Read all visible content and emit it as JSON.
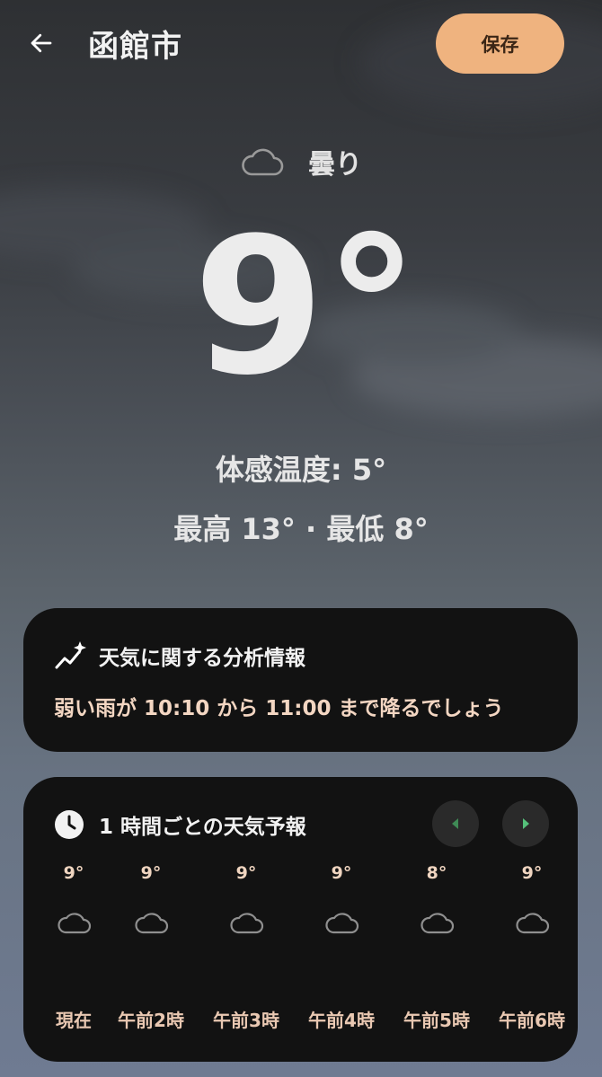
{
  "header": {
    "back_icon": "arrow-back-icon",
    "city": "函館市",
    "save_label": "保存"
  },
  "current": {
    "condition_icon": "cloud-icon",
    "condition": "曇り",
    "temperature": "9°",
    "feels_like": "体感温度: 5°",
    "high_low": "最高 13° · 最低 8°"
  },
  "insight": {
    "icon": "sparkle-trend-icon",
    "title": "天気に関する分析情報",
    "text": "弱い雨が 10:10 から 11:00 まで降るでしょう"
  },
  "hourly": {
    "icon": "clock-icon",
    "title": "1 時間ごとの天気予報",
    "prev_icon": "chevron-left-icon",
    "next_icon": "chevron-right-icon",
    "items": [
      {
        "temp": "9°",
        "icon": "cloud-icon",
        "label": "現在"
      },
      {
        "temp": "9°",
        "icon": "cloud-icon",
        "label": "午前2時"
      },
      {
        "temp": "9°",
        "icon": "cloud-icon",
        "label": "午前3時"
      },
      {
        "temp": "9°",
        "icon": "cloud-icon",
        "label": "午前4時"
      },
      {
        "temp": "8°",
        "icon": "cloud-icon",
        "label": "午前5時"
      },
      {
        "temp": "9°",
        "icon": "cloud-icon",
        "label": "午前6時"
      }
    ]
  },
  "colors": {
    "accent": "#efb37f",
    "card": "#121212",
    "insight_text": "#f3d6c2",
    "nav_prev_arrow": "#3f8a55",
    "nav_next_arrow": "#55c07a"
  }
}
